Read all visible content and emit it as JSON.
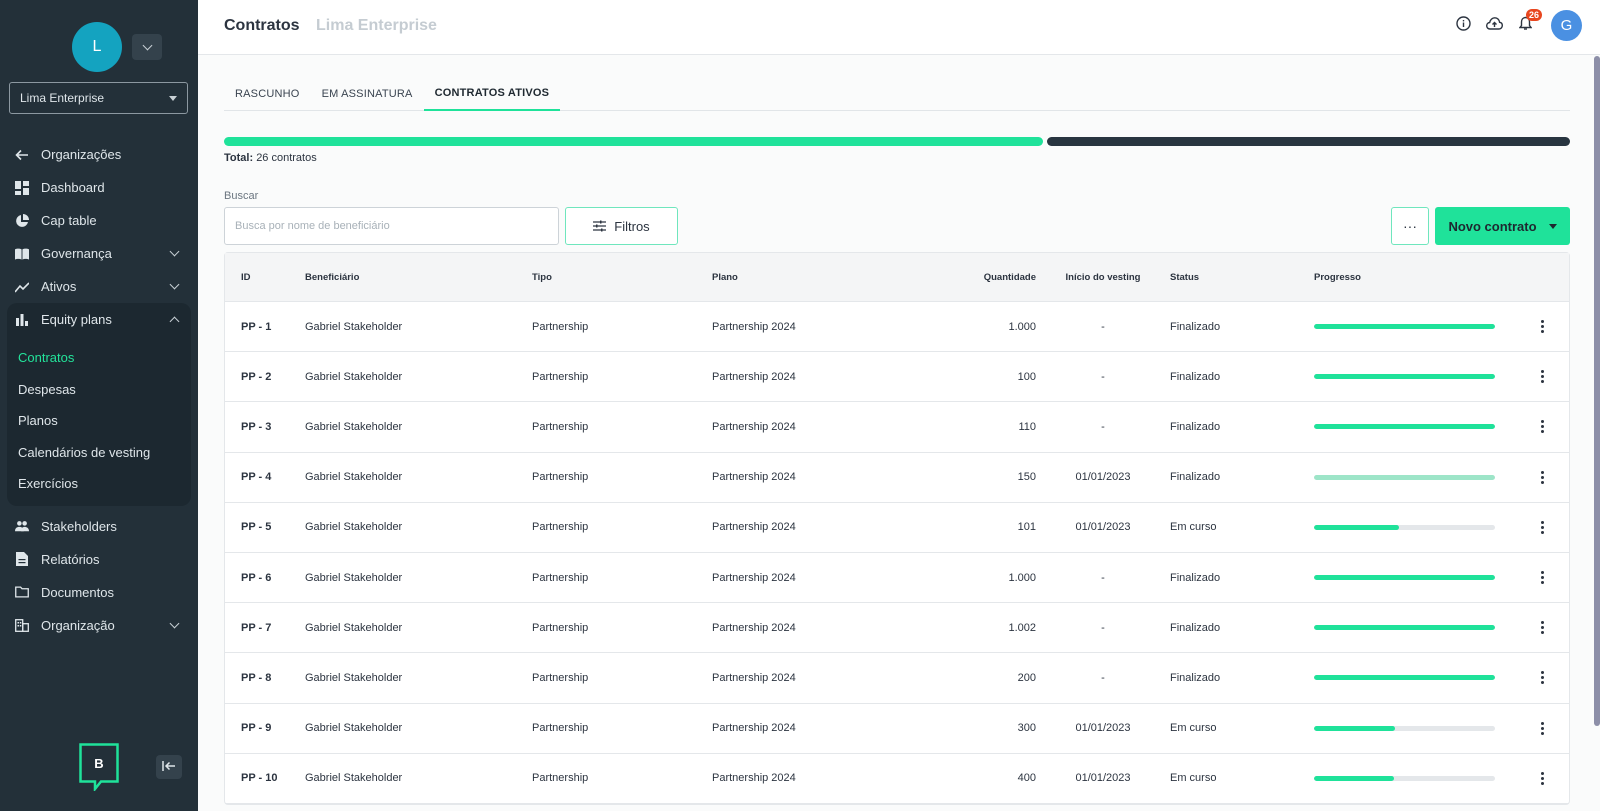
{
  "sidebar": {
    "avatar_letter": "L",
    "org_select": "Lima Enterprise",
    "nav": {
      "organizacoes": "Organizações",
      "dashboard": "Dashboard",
      "cap_table": "Cap table",
      "governanca": "Governança",
      "ativos": "Ativos",
      "equity_plans": "Equity plans",
      "stakeholders": "Stakeholders",
      "relatorios": "Relatórios",
      "documentos": "Documentos",
      "organizacao": "Organização"
    },
    "equity_sub": {
      "contratos": "Contratos",
      "despesas": "Despesas",
      "planos": "Planos",
      "calendarios": "Calendários de vesting",
      "exercicios": "Exercícios"
    },
    "brand_letter": "B"
  },
  "header": {
    "title": "Contratos",
    "subtitle": "Lima Enterprise",
    "notifications_count": "26",
    "user_initial": "G"
  },
  "tabs": {
    "rascunho": "RASCUNHO",
    "em_assinatura": "EM ASSINATURA",
    "contratos_ativos": "CONTRATOS ATIVOS"
  },
  "summary": {
    "total_label": "Total:",
    "total_value": "26 contratos",
    "completed_fraction": 0.61
  },
  "search": {
    "label": "Buscar",
    "placeholder": "Busca por nome de beneficiário",
    "filters_label": "Filtros",
    "more_label": "···",
    "new_contract_label": "Novo contrato"
  },
  "table": {
    "headers": {
      "id": "ID",
      "beneficiario": "Beneficiário",
      "tipo": "Tipo",
      "plano": "Plano",
      "quantidade": "Quantidade",
      "inicio": "Início do vesting",
      "status": "Status",
      "progresso": "Progresso"
    },
    "rows": [
      {
        "id": "PP - 1",
        "beneficiario": "Gabriel Stakeholder",
        "tipo": "Partnership",
        "plano": "Partnership 2024",
        "quantidade": "1.000",
        "inicio": "-",
        "status": "Finalizado",
        "progress": 1.0,
        "light": false
      },
      {
        "id": "PP - 2",
        "beneficiario": "Gabriel Stakeholder",
        "tipo": "Partnership",
        "plano": "Partnership 2024",
        "quantidade": "100",
        "inicio": "-",
        "status": "Finalizado",
        "progress": 1.0,
        "light": false
      },
      {
        "id": "PP - 3",
        "beneficiario": "Gabriel Stakeholder",
        "tipo": "Partnership",
        "plano": "Partnership 2024",
        "quantidade": "110",
        "inicio": "-",
        "status": "Finalizado",
        "progress": 1.0,
        "light": false
      },
      {
        "id": "PP - 4",
        "beneficiario": "Gabriel Stakeholder",
        "tipo": "Partnership",
        "plano": "Partnership 2024",
        "quantidade": "150",
        "inicio": "01/01/2023",
        "status": "Finalizado",
        "progress": 1.0,
        "light": true
      },
      {
        "id": "PP - 5",
        "beneficiario": "Gabriel Stakeholder",
        "tipo": "Partnership",
        "plano": "Partnership 2024",
        "quantidade": "101",
        "inicio": "01/01/2023",
        "status": "Em curso",
        "progress": 0.47,
        "light": false
      },
      {
        "id": "PP - 6",
        "beneficiario": "Gabriel Stakeholder",
        "tipo": "Partnership",
        "plano": "Partnership 2024",
        "quantidade": "1.000",
        "inicio": "-",
        "status": "Finalizado",
        "progress": 1.0,
        "light": false
      },
      {
        "id": "PP - 7",
        "beneficiario": "Gabriel Stakeholder",
        "tipo": "Partnership",
        "plano": "Partnership 2024",
        "quantidade": "1.002",
        "inicio": "-",
        "status": "Finalizado",
        "progress": 1.0,
        "light": false
      },
      {
        "id": "PP - 8",
        "beneficiario": "Gabriel Stakeholder",
        "tipo": "Partnership",
        "plano": "Partnership 2024",
        "quantidade": "200",
        "inicio": "-",
        "status": "Finalizado",
        "progress": 1.0,
        "light": false
      },
      {
        "id": "PP - 9",
        "beneficiario": "Gabriel Stakeholder",
        "tipo": "Partnership",
        "plano": "Partnership 2024",
        "quantidade": "300",
        "inicio": "01/01/2023",
        "status": "Em curso",
        "progress": 0.45,
        "light": false
      },
      {
        "id": "PP - 10",
        "beneficiario": "Gabriel Stakeholder",
        "tipo": "Partnership",
        "plano": "Partnership 2024",
        "quantidade": "400",
        "inicio": "01/01/2023",
        "status": "Em curso",
        "progress": 0.44,
        "light": false
      }
    ]
  },
  "colors": {
    "accent": "#1fe29a",
    "sidebar_bg": "#233039",
    "avatar_bg": "#14a3c0",
    "user_avatar_bg": "#4a90e2",
    "badge_bg": "#e8461f"
  },
  "icons": [
    "arrow-left-icon",
    "dashboard-icon",
    "pie-chart-icon",
    "book-icon",
    "trend-icon",
    "bar-chart-icon",
    "users-icon",
    "report-icon",
    "folder-icon",
    "building-icon",
    "info-icon",
    "cloud-upload-icon",
    "bell-icon",
    "filter-icon",
    "collapse-icon"
  ]
}
